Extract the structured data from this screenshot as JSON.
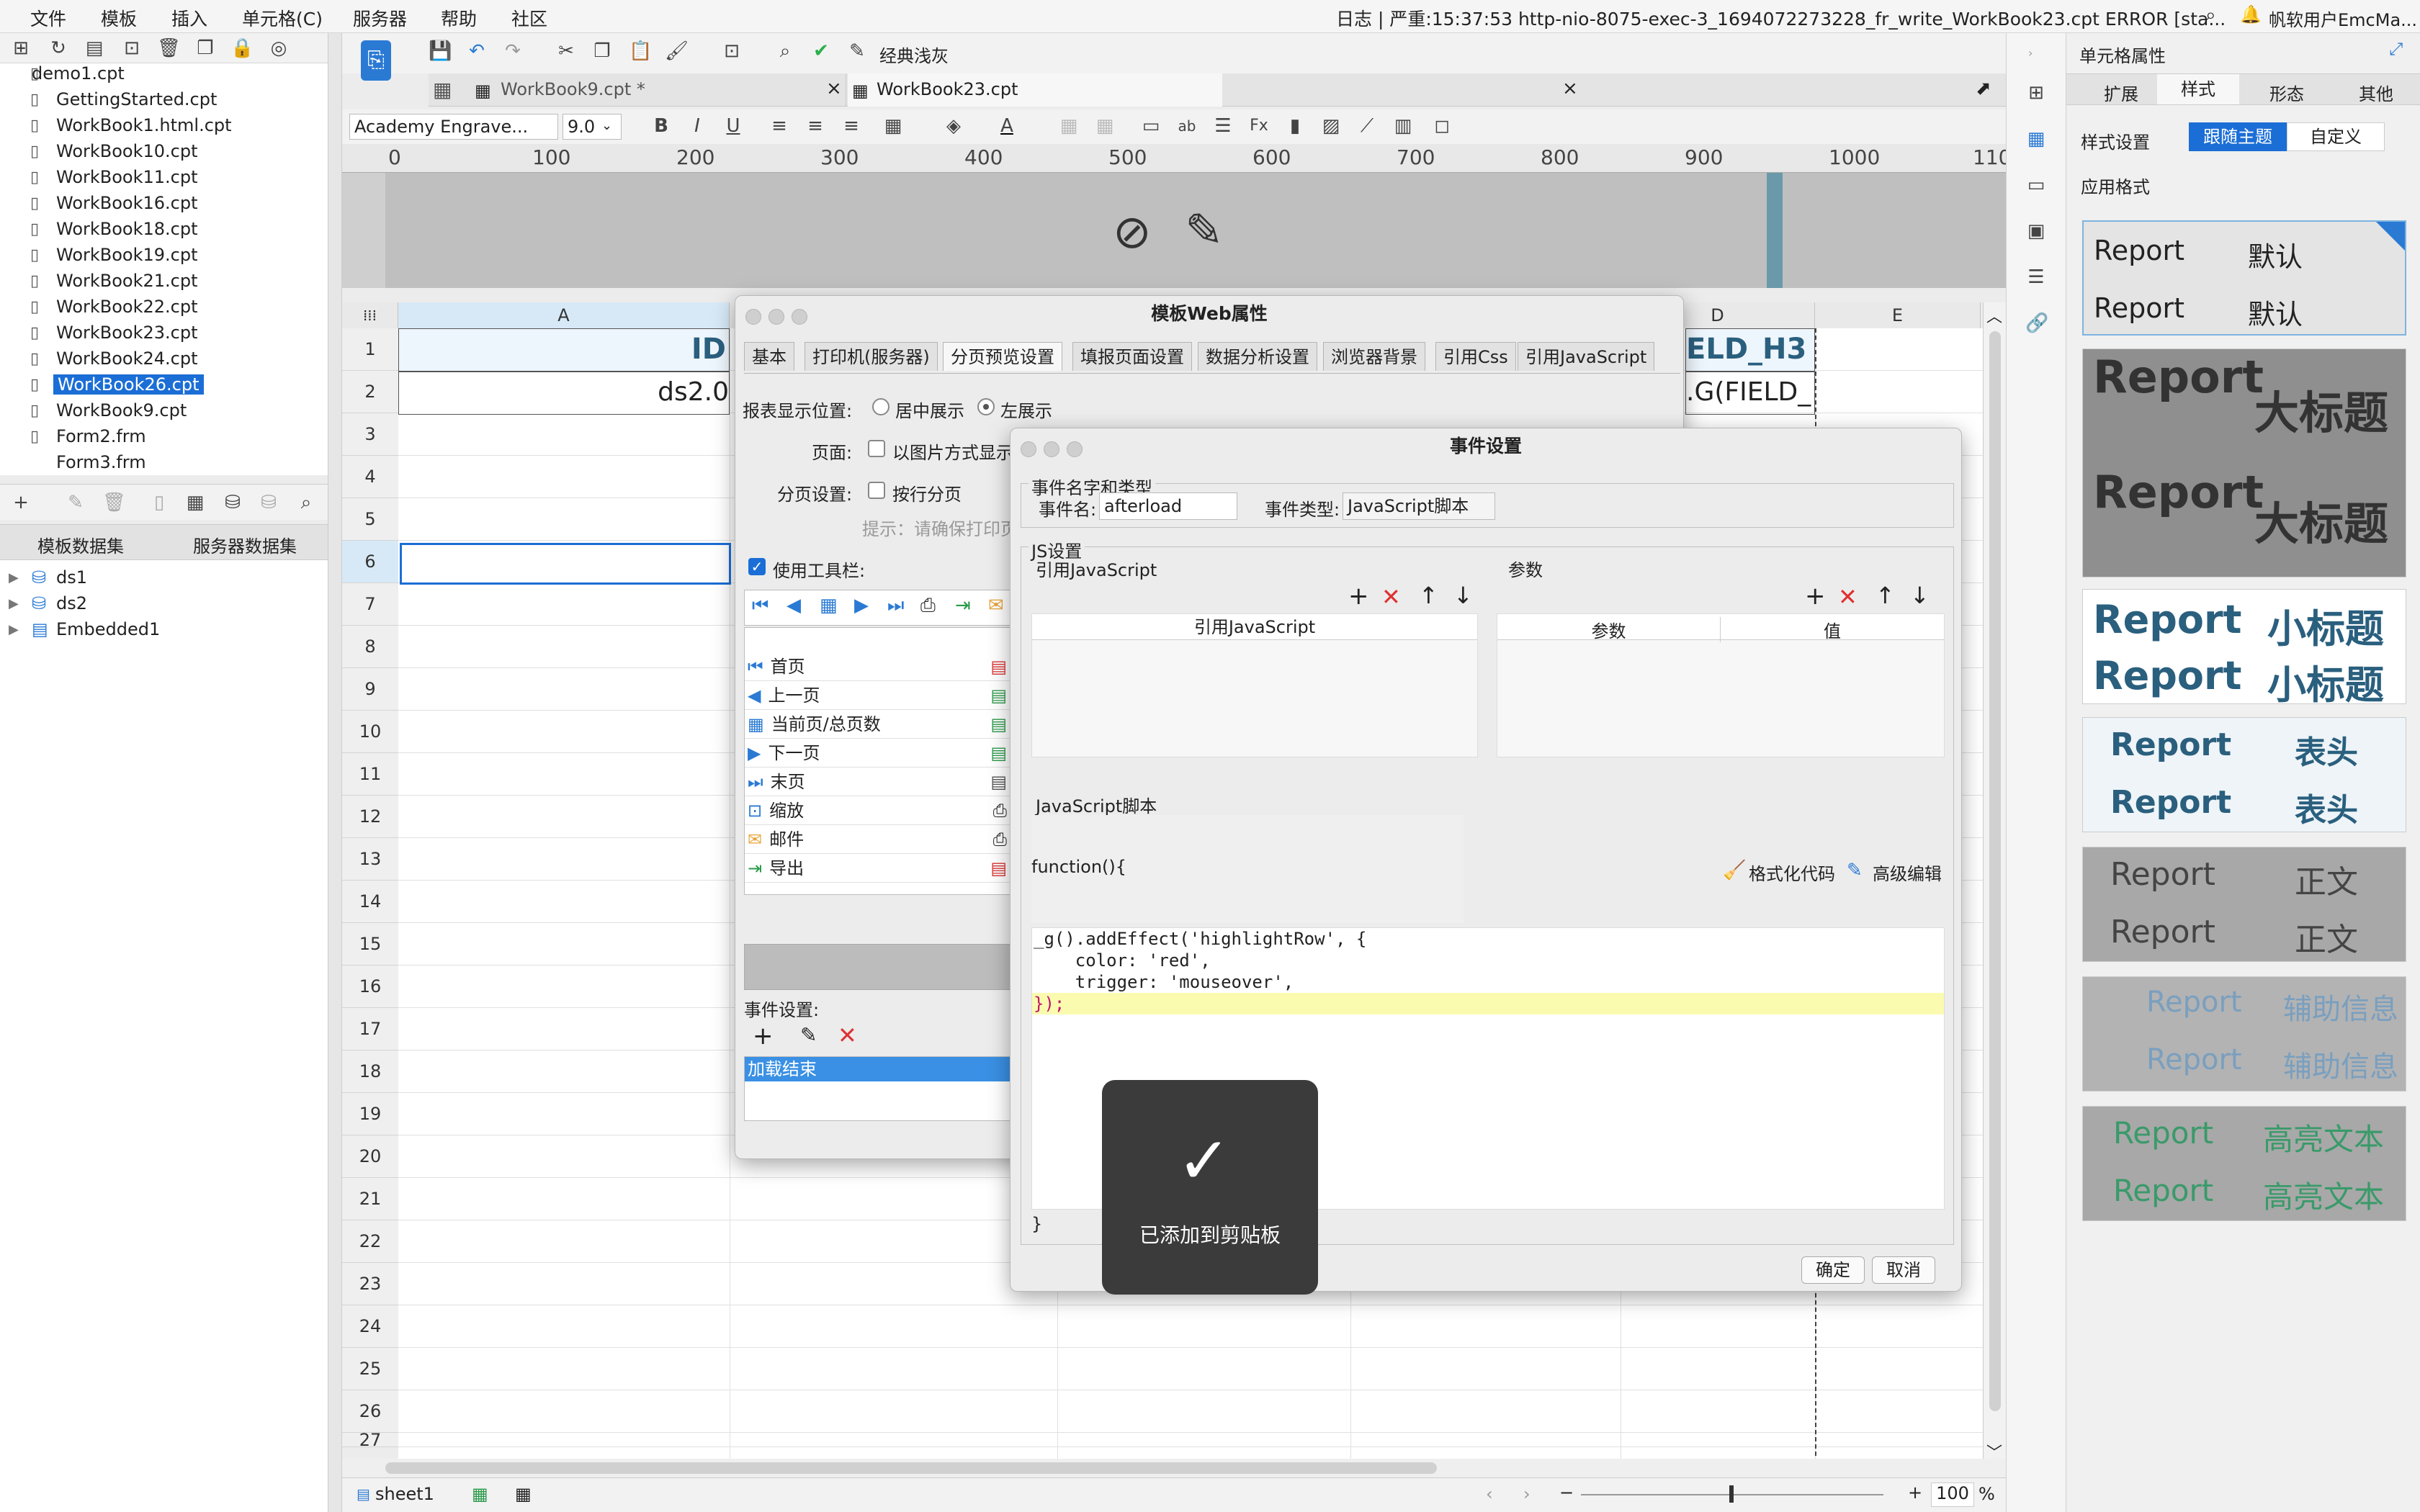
{
  "menubar": {
    "items": [
      "文件",
      "模板",
      "插入",
      "单元格(C)",
      "服务器",
      "帮助",
      "社区"
    ],
    "status": "日志 | 严重:15:37:53 http-nio-8075-exec-3_1694072273228_fr_write_WorkBook23.cpt ERROR [sta...",
    "user": "帆软用户EmcMa..."
  },
  "toolbar": {
    "theme_label": "经典浅灰"
  },
  "files": {
    "items": [
      "demo1.cpt",
      "GettingStarted.cpt",
      "WorkBook1.html.cpt",
      "WorkBook10.cpt",
      "WorkBook11.cpt",
      "WorkBook16.cpt",
      "WorkBook18.cpt",
      "WorkBook19.cpt",
      "WorkBook21.cpt",
      "WorkBook22.cpt",
      "WorkBook23.cpt",
      "WorkBook24.cpt",
      "WorkBook26.cpt",
      "WorkBook9.cpt",
      "Form2.frm",
      "Form3.frm"
    ],
    "selected": "WorkBook26.cpt"
  },
  "datasets": {
    "tab_template": "模板数据集",
    "tab_server": "服务器数据集",
    "items": [
      "ds1",
      "ds2",
      "Embedded1"
    ]
  },
  "doc_tabs": [
    "WorkBook9.cpt *",
    "WorkBook23.cpt"
  ],
  "format": {
    "font": "Academy Engrave...",
    "size": "9.0"
  },
  "ruler": [
    "0",
    "100",
    "200",
    "300",
    "400",
    "500",
    "600",
    "700",
    "800",
    "900",
    "1000",
    "110"
  ],
  "grid": {
    "columns": [
      "A",
      "D",
      "E"
    ],
    "rows": [
      "1",
      "2",
      "3",
      "4",
      "5",
      "6",
      "7",
      "8",
      "9",
      "10",
      "11",
      "12",
      "13",
      "14",
      "15",
      "16",
      "17",
      "18",
      "19",
      "20",
      "21",
      "22",
      "23",
      "24",
      "25",
      "26",
      "27"
    ],
    "cell_a1": "ID",
    "cell_a2": "ds2.0",
    "cell_d1": "ELD_H3",
    "cell_d2": ".G(FIELD_"
  },
  "web_dialog": {
    "title": "模板Web属性",
    "tabs": [
      "基本",
      "打印机(服务器)",
      "分页预览设置",
      "填报页面设置",
      "数据分析设置",
      "浏览器背景",
      "引用Css",
      "引用JavaScript"
    ],
    "position_label": "报表显示位置:",
    "pos_center": "居中展示",
    "pos_left": "左展示",
    "page_label": "页面:",
    "page_opt": "以图片方式显示",
    "paging_label": "分页设置:",
    "paging_opt": "按行分页",
    "hint": "提示：请确保打印页",
    "toolbar_label": "使用工具栏:",
    "buttons": [
      "首页",
      "上一页",
      "当前页/总页数",
      "下一页",
      "末页",
      "缩放",
      "邮件",
      "导出"
    ],
    "event_label": "事件设置:",
    "event_item": "加载结束"
  },
  "event_dialog": {
    "title": "事件设置",
    "name_group": "事件名字和类型",
    "name_label": "事件名:",
    "name_value": "afterload",
    "type_label": "事件类型:",
    "type_value": "JavaScript脚本",
    "js_group": "JS设置",
    "ref_js": "引用JavaScript",
    "params": "参数",
    "col_ref": "引用JavaScript",
    "col_param": "参数",
    "col_value": "值",
    "script_label": "JavaScript脚本",
    "fn_open": "function(){",
    "format_code": "格式化代码",
    "advanced_edit": "高级编辑",
    "code_line1": "_g().addEffect('highlightRow', {",
    "code_line2": "    color: 'red',",
    "code_line3": "    trigger: 'mouseover',",
    "code_line4": "});",
    "fn_close": "}",
    "ok": "确定",
    "cancel": "取消"
  },
  "toast": {
    "text": "已添加到剪贴板"
  },
  "right_panel": {
    "title": "单元格属性",
    "tabs": [
      "扩展",
      "样式",
      "形态",
      "其他"
    ],
    "style_label": "样式设置",
    "follow_theme": "跟随主题",
    "custom": "自定义",
    "apply_label": "应用格式",
    "cards": [
      {
        "l": "Report",
        "r": "默认"
      },
      {
        "l": "Report",
        "r": "大标题"
      },
      {
        "l": "Report",
        "r": "小标题"
      },
      {
        "l": "Report",
        "r": "表头"
      },
      {
        "l": "Report",
        "r": "正文"
      },
      {
        "l": "Report",
        "r": "辅助信息"
      },
      {
        "l": "Report",
        "r": "高亮文本"
      }
    ]
  },
  "statusbar": {
    "sheet": "sheet1",
    "zoom": "100",
    "pct": "%"
  }
}
